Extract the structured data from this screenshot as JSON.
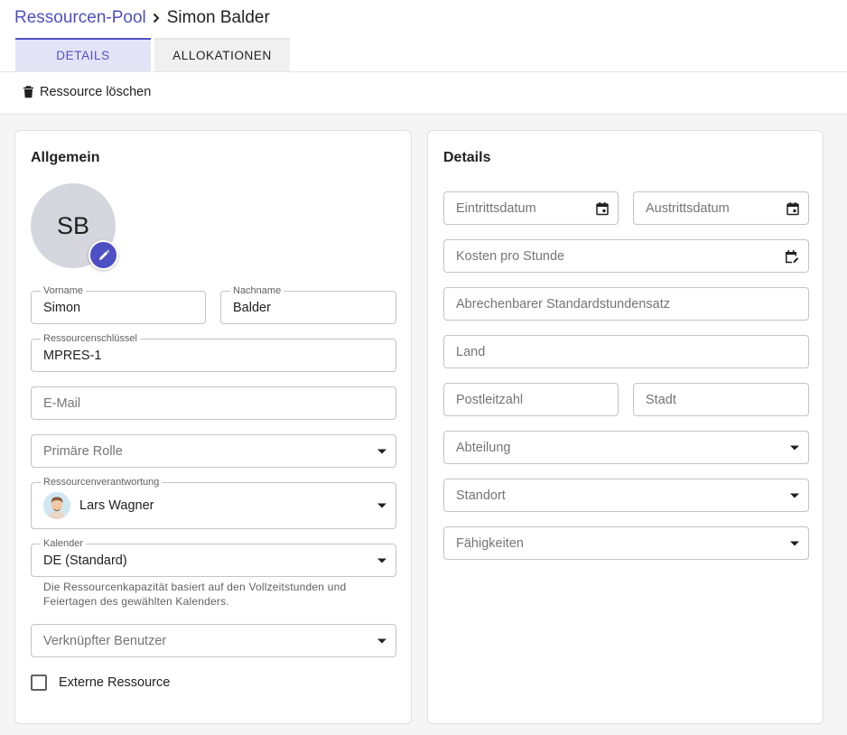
{
  "breadcrumb": {
    "parent": "Ressourcen-Pool",
    "current": "Simon Balder"
  },
  "tabs": [
    {
      "label": "DETAILS",
      "active": true
    },
    {
      "label": "ALLOKATIONEN",
      "active": false
    }
  ],
  "toolbar": {
    "delete_label": "Ressource löschen"
  },
  "general": {
    "title": "Allgemein",
    "avatar_initials": "SB",
    "first_name": {
      "label": "Vorname",
      "value": "Simon"
    },
    "last_name": {
      "label": "Nachname",
      "value": "Balder"
    },
    "resource_key": {
      "label": "Ressourcenschlüssel",
      "value": "MPRES-1"
    },
    "email": {
      "placeholder": "E-Mail"
    },
    "primary_role": {
      "placeholder": "Primäre Rolle"
    },
    "responsible": {
      "label": "Ressourcenverantwortung",
      "value": "Lars Wagner"
    },
    "calendar": {
      "label": "Kalender",
      "value": "DE (Standard)",
      "helper": "Die Ressourcenkapazität basiert auf den Vollzeitstunden und Feiertagen des gewählten Kalenders."
    },
    "linked_user": {
      "placeholder": "Verknüpfter Benutzer"
    },
    "external": {
      "label": "Externe Ressource",
      "checked": false
    }
  },
  "details": {
    "title": "Details",
    "entry_date": {
      "placeholder": "Eintrittsdatum"
    },
    "exit_date": {
      "placeholder": "Austrittsdatum"
    },
    "cost_per_hour": {
      "placeholder": "Kosten pro Stunde"
    },
    "billable_rate": {
      "placeholder": "Abrechenbarer Standardstundensatz"
    },
    "country": {
      "placeholder": "Land"
    },
    "postal_code": {
      "placeholder": "Postleitzahl"
    },
    "city": {
      "placeholder": "Stadt"
    },
    "department": {
      "placeholder": "Abteilung"
    },
    "location": {
      "placeholder": "Standort"
    },
    "skills": {
      "placeholder": "Fähigkeiten"
    }
  },
  "colors": {
    "accent": "#4f4fc4",
    "tab_active_bg": "#e4e4f8",
    "border": "#c4c4c4"
  },
  "icons": [
    "chevron-right-icon",
    "trash-icon",
    "pencil-icon",
    "calendar-icon",
    "calendar-edit-icon",
    "dropdown-arrow-icon"
  ]
}
